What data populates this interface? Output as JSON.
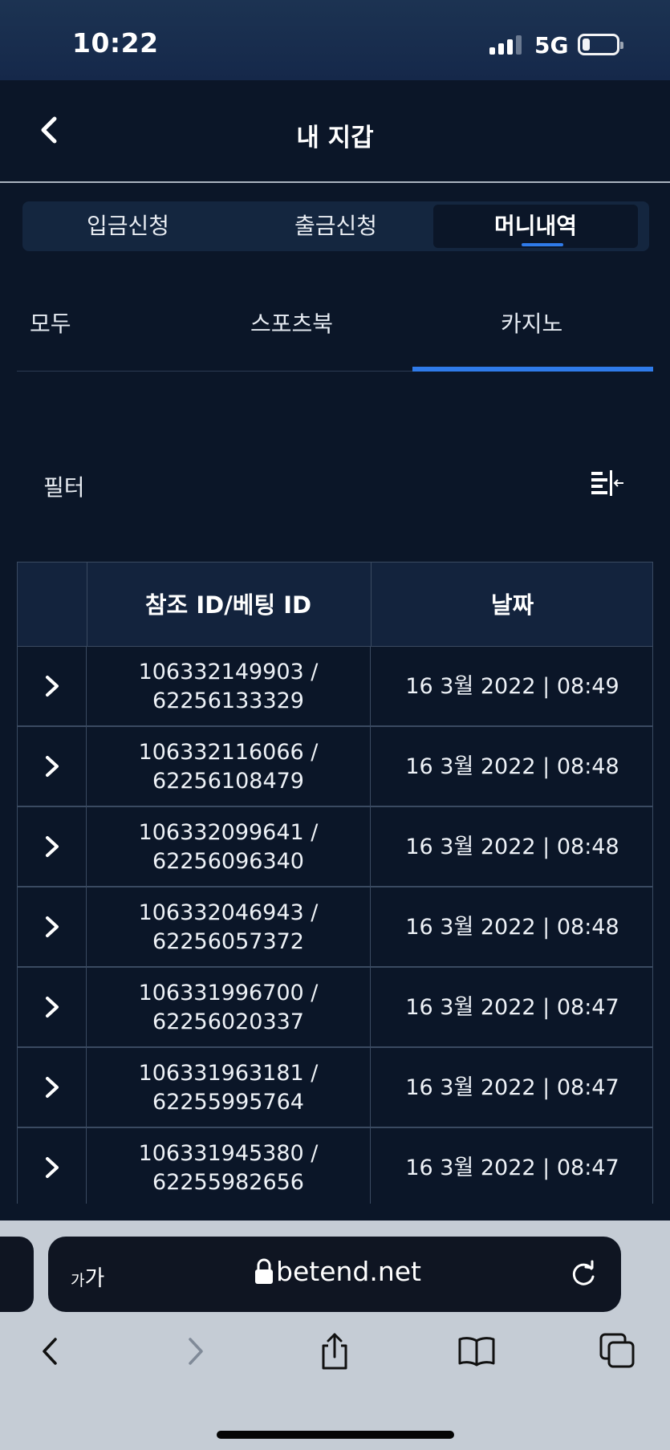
{
  "status": {
    "time": "10:22",
    "network": "5G",
    "battery_level": 0.15
  },
  "header": {
    "title": "내 지갑",
    "back_icon": "chevron-left-icon"
  },
  "segments": [
    {
      "label": "입금신청",
      "active": false
    },
    {
      "label": "출금신청",
      "active": false
    },
    {
      "label": "머니내역",
      "active": true
    }
  ],
  "categories": [
    {
      "label": "모두",
      "active": false
    },
    {
      "label": "스포츠북",
      "active": false
    },
    {
      "label": "카지노",
      "active": true
    }
  ],
  "filter": {
    "label": "필터",
    "icon": "filter-collapse-icon"
  },
  "table": {
    "headers": [
      "",
      "참조 ID/베팅 ID",
      "날짜"
    ],
    "rows": [
      {
        "ref": "106332149903 /",
        "bet": "62256133329",
        "date": "16 3월 2022 | 08:49"
      },
      {
        "ref": "106332116066 /",
        "bet": "62256108479",
        "date": "16 3월 2022 | 08:48"
      },
      {
        "ref": "106332099641 /",
        "bet": "62256096340",
        "date": "16 3월 2022 | 08:48"
      },
      {
        "ref": "106332046943 /",
        "bet": "62256057372",
        "date": "16 3월 2022 | 08:48"
      },
      {
        "ref": "106331996700 /",
        "bet": "62256020337",
        "date": "16 3월 2022 | 08:47"
      },
      {
        "ref": "106331963181 /",
        "bet": "62255995764",
        "date": "16 3월 2022 | 08:47"
      },
      {
        "ref": "106331945380 /",
        "bet": "62255982656",
        "date": "16 3월 2022 | 08:47"
      }
    ]
  },
  "browser": {
    "text_size_label_small": "가",
    "text_size_label_large": "가",
    "url": "betend.net",
    "toolbar": [
      "back-icon",
      "forward-icon",
      "share-icon",
      "bookmarks-icon",
      "tabs-icon"
    ]
  },
  "colors": {
    "accent": "#2f7bea",
    "background": "#0b1628",
    "header_bg": "#13233d"
  }
}
